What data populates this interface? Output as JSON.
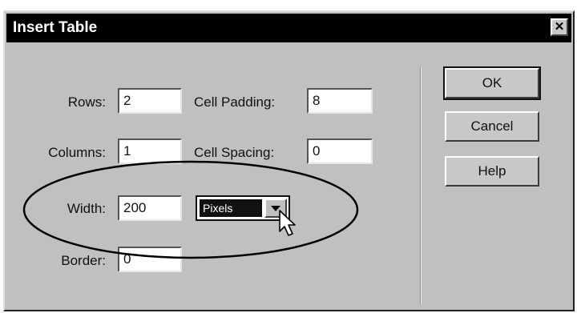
{
  "dialog": {
    "title": "Insert Table",
    "close_glyph": "✕",
    "fields": {
      "rows": {
        "label": "Rows:",
        "value": "2"
      },
      "columns": {
        "label": "Columns:",
        "value": "1"
      },
      "width": {
        "label": "Width:",
        "value": "200"
      },
      "border": {
        "label": "Border:",
        "value": "0"
      },
      "cell_padding": {
        "label": "Cell Padding:",
        "value": "8"
      },
      "cell_spacing": {
        "label": "Cell Spacing:",
        "value": "0"
      }
    },
    "width_unit": {
      "selected": "Pixels"
    },
    "buttons": {
      "ok": "OK",
      "cancel": "Cancel",
      "help": "Help"
    }
  },
  "icons": [
    "close-icon",
    "dropdown-arrow-icon",
    "mouse-pointer-icon"
  ],
  "annotation": {
    "shape": "ellipse",
    "color": "#000000"
  }
}
